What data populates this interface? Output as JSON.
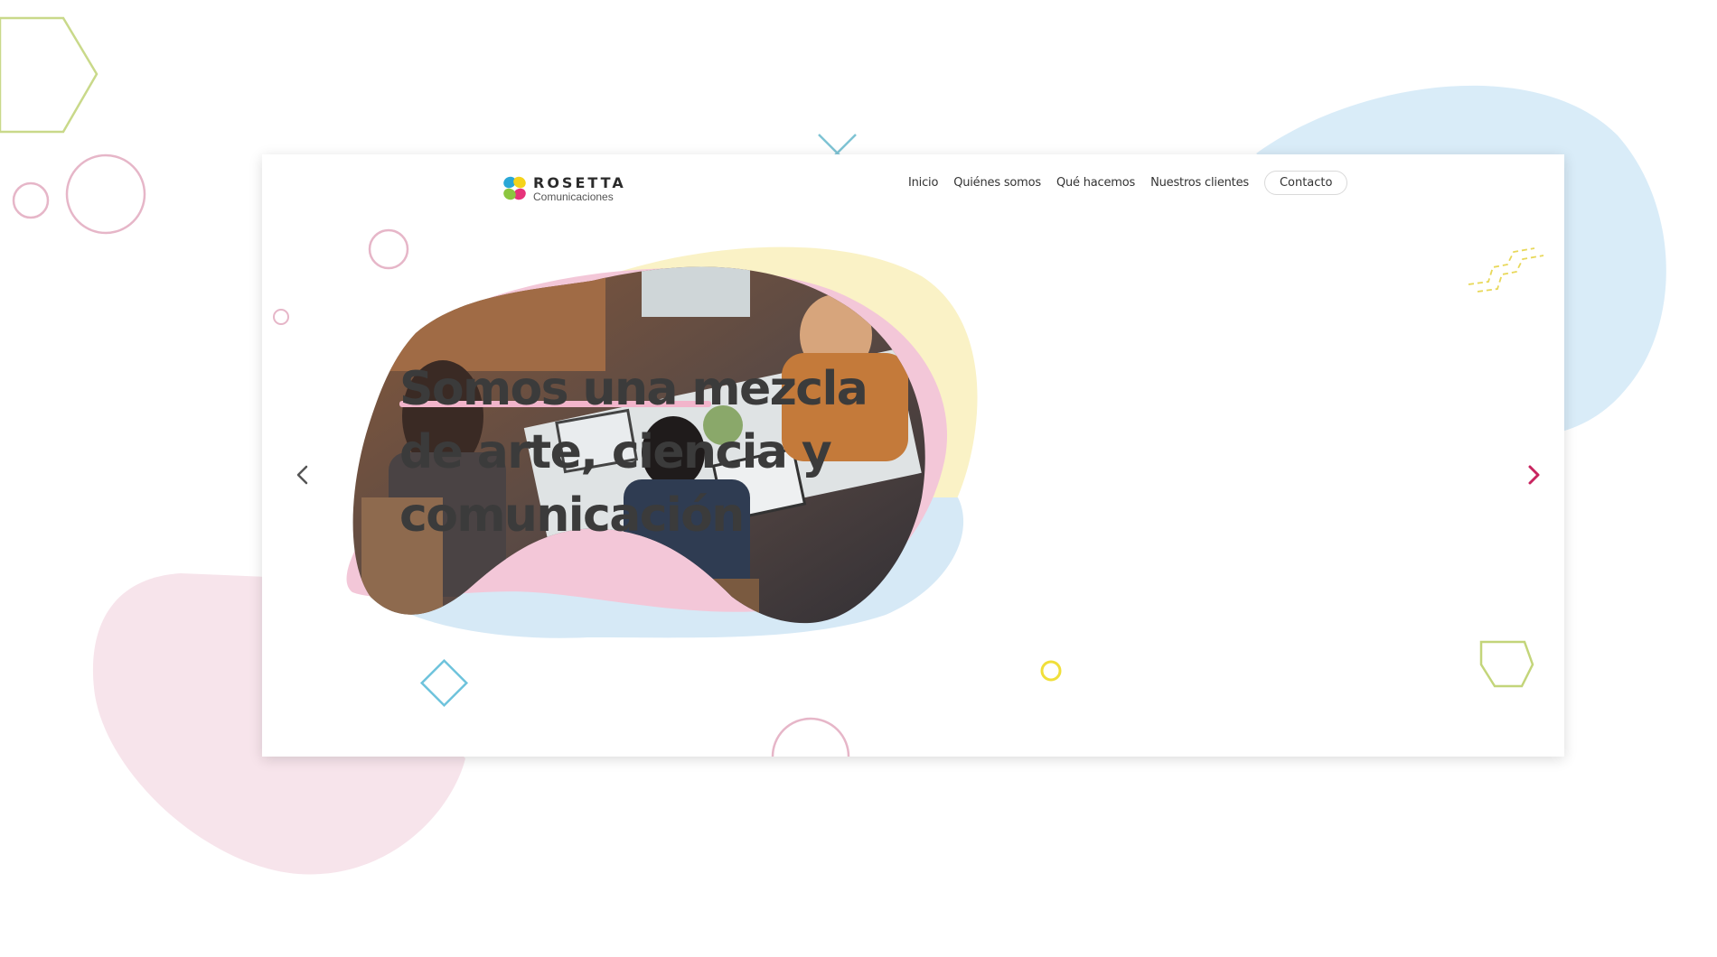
{
  "logo": {
    "name": "ROSETTA",
    "subtitle": "Comunicaciones",
    "petal_colors": [
      "#2aa7d6",
      "#f5d31a",
      "#e6337a",
      "#8cc63f"
    ]
  },
  "nav": {
    "items": [
      {
        "label": "Inicio",
        "active": true
      },
      {
        "label": "Quiénes somos",
        "active": false
      },
      {
        "label": "Qué hacemos",
        "active": false
      },
      {
        "label": "Nuestros clientes",
        "active": false
      }
    ],
    "contact_label": "Contacto"
  },
  "hero": {
    "headline": [
      "Somos una mezcla",
      "de arte, ciencia y",
      "comunicación"
    ],
    "image": "team-working-on-laptops-photo"
  },
  "carousel": {
    "prev_icon": "chevron-left-icon",
    "next_icon": "chevron-right-icon"
  },
  "colors": {
    "pink": "#e6b6c8",
    "light_pink": "#f6e3ea",
    "light_blue": "#d8ebf7",
    "teal": "#7ec3d4",
    "yellow": "#f0df3a",
    "green": "#c3d57a",
    "magenta": "#c8245f",
    "text": "#3b3b3b"
  }
}
